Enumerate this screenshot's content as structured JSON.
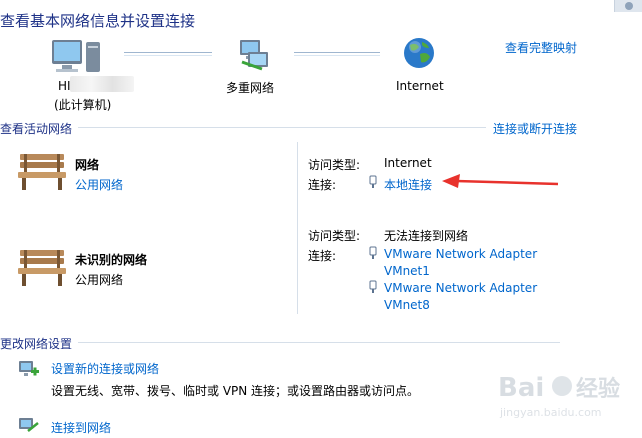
{
  "header": {
    "title": "查看基本网络信息并设置连接",
    "full_map_link": "查看完整映射"
  },
  "map": {
    "computer_label": "HI",
    "computer_sublabel": "(此计算机)",
    "multi_label": "多重网络",
    "internet_label": "Internet"
  },
  "active": {
    "section_title": "查看活动网络",
    "connect_link": "连接或断开连接",
    "networks": [
      {
        "name": "网络",
        "type_link": "公用网络",
        "access_label": "访问类型:",
        "access_value": "Internet",
        "conn_label": "连接:",
        "conn_link": "本地连接"
      },
      {
        "name": "未识别的网络",
        "type_text": "公用网络",
        "access_label": "访问类型:",
        "access_value": "无法连接到网络",
        "conn_label": "连接:",
        "adapters": [
          {
            "line1": "VMware Network Adapter",
            "line2": "VMnet1"
          },
          {
            "line1": "VMware Network Adapter",
            "line2": "VMnet8"
          }
        ]
      }
    ]
  },
  "settings": {
    "section_title": "更改网络设置",
    "items": [
      {
        "link": "设置新的连接或网络",
        "desc": "设置无线、宽带、拨号、临时或 VPN 连接；或设置路由器或访问点。"
      },
      {
        "link": "连接到网络"
      }
    ]
  },
  "colors": {
    "title": "#1e3287",
    "link": "#0066cc",
    "arrow": "#e8322c"
  }
}
